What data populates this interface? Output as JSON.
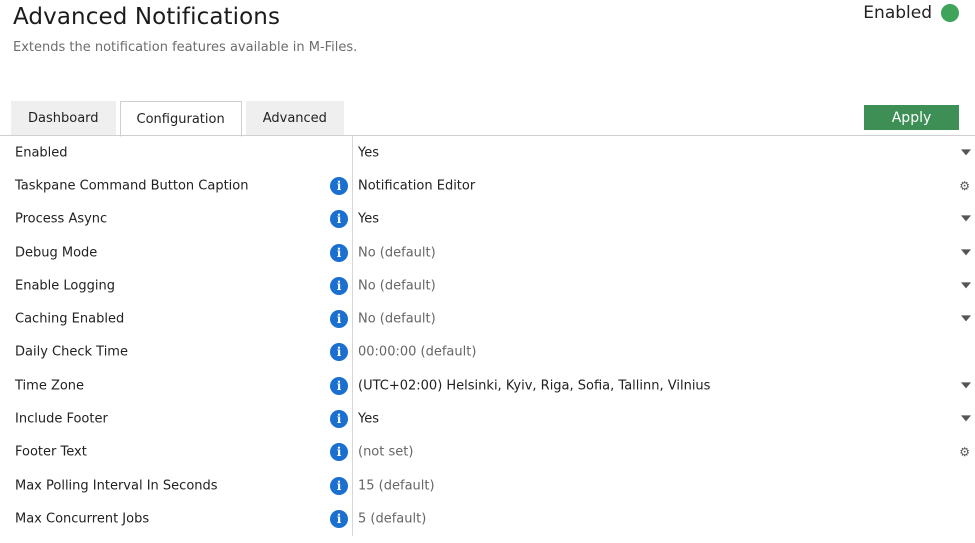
{
  "header": {
    "title": "Advanced Notifications",
    "subtitle": "Extends the notification features available in M-Files.",
    "status_label": "Enabled",
    "status_color": "#3fa45a"
  },
  "tabs": [
    {
      "label": "Dashboard",
      "active": false
    },
    {
      "label": "Configuration",
      "active": true
    },
    {
      "label": "Advanced",
      "active": false
    }
  ],
  "apply_label": "Apply",
  "accent_color": "#3d8f56",
  "rows": [
    {
      "label": "Enabled",
      "value": "Yes",
      "info": false,
      "control": "dropdown",
      "default": false
    },
    {
      "label": "Taskpane Command Button Caption",
      "value": "Notification Editor",
      "info": true,
      "control": "gear",
      "default": false
    },
    {
      "label": "Process Async",
      "value": "Yes",
      "info": true,
      "control": "dropdown",
      "default": false
    },
    {
      "label": "Debug Mode",
      "value": "No (default)",
      "info": true,
      "control": "dropdown",
      "default": true
    },
    {
      "label": "Enable Logging",
      "value": "No (default)",
      "info": true,
      "control": "dropdown",
      "default": true
    },
    {
      "label": "Caching Enabled",
      "value": "No (default)",
      "info": true,
      "control": "dropdown",
      "default": true
    },
    {
      "label": "Daily Check Time",
      "value": "00:00:00 (default)",
      "info": true,
      "control": "none",
      "default": true
    },
    {
      "label": "Time Zone",
      "value": "(UTC+02:00) Helsinki, Kyiv, Riga, Sofia, Tallinn, Vilnius",
      "info": true,
      "control": "dropdown",
      "default": false
    },
    {
      "label": "Include Footer",
      "value": "Yes",
      "info": true,
      "control": "dropdown",
      "default": false
    },
    {
      "label": "Footer Text",
      "value": "(not set)",
      "info": true,
      "control": "gear",
      "default": true
    },
    {
      "label": "Max Polling Interval In Seconds",
      "value": "15 (default)",
      "info": true,
      "control": "none",
      "default": true
    },
    {
      "label": "Max Concurrent Jobs",
      "value": "5 (default)",
      "info": true,
      "control": "none",
      "default": true
    }
  ]
}
